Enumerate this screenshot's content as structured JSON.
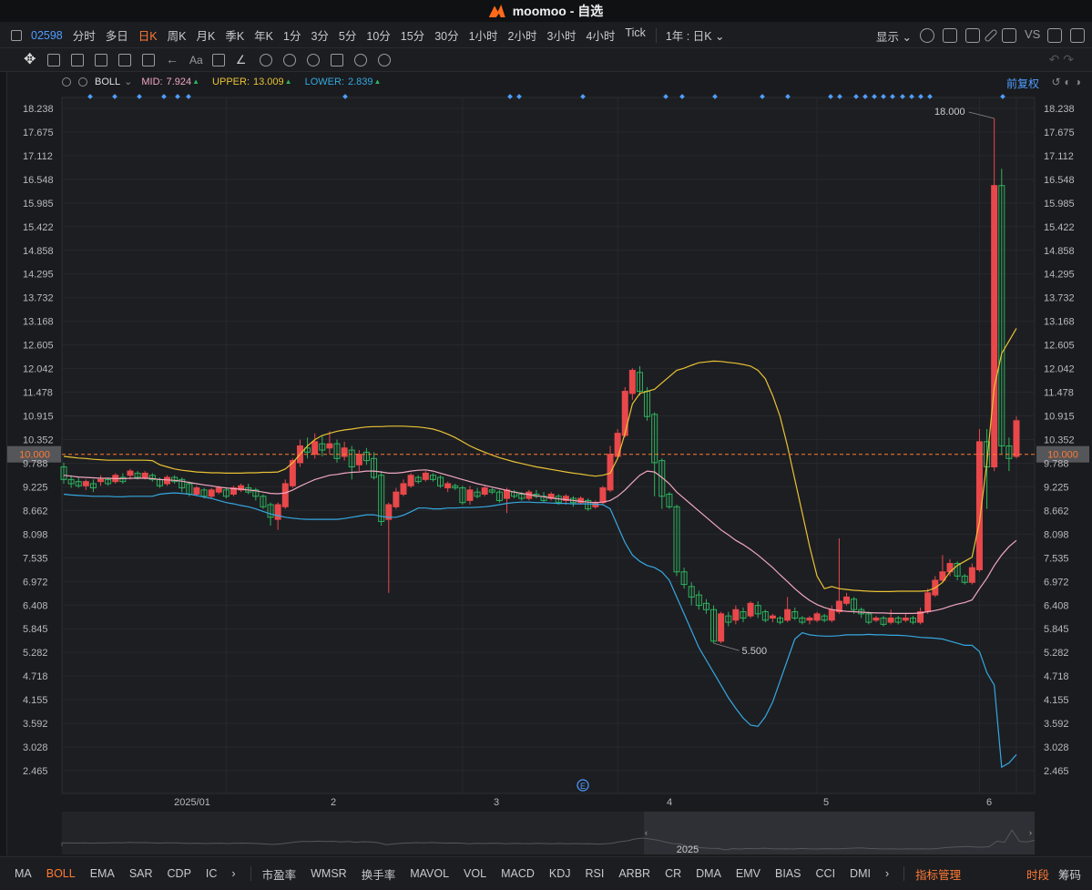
{
  "window": {
    "title": "moomoo - 自选"
  },
  "toolbar": {
    "code": "02598",
    "periods": [
      "分时",
      "多日",
      "日K",
      "周K",
      "月K",
      "季K",
      "年K",
      "1分",
      "3分",
      "5分",
      "10分",
      "15分",
      "30分",
      "1小时",
      "2小时",
      "3小时",
      "4小时",
      "Tick"
    ],
    "selected_period": "日K",
    "range_label": "1年 : 日K",
    "display_label": "显示"
  },
  "indicator": {
    "name": "BOLL",
    "mid_label": "MID:",
    "mid_value": "7.924",
    "upper_label": "UPPER:",
    "upper_value": "13.009",
    "lower_label": "LOWER:",
    "lower_value": "2.839",
    "adjust_label": "前复权"
  },
  "chart_data": {
    "type": "candlestick",
    "y_ticks": [
      "18.238",
      "17.675",
      "17.112",
      "16.548",
      "15.985",
      "15.422",
      "14.858",
      "14.295",
      "13.732",
      "13.168",
      "12.605",
      "12.042",
      "11.478",
      "10.915",
      "10.352",
      "9.788",
      "9.225",
      "8.662",
      "8.098",
      "7.535",
      "6.972",
      "6.408",
      "5.845",
      "5.282",
      "4.718",
      "4.155",
      "3.592",
      "3.028",
      "2.465"
    ],
    "ylim": [
      2.465,
      18.238
    ],
    "x_ticks": [
      "2025/01",
      "2",
      "3",
      "4",
      "5",
      "6"
    ],
    "current_price": "10.000",
    "high_annotation": "18.000",
    "low_annotation": "5.500",
    "candles": [
      [
        9.7,
        9.4,
        9.8,
        9.3
      ],
      [
        9.4,
        9.3,
        9.5,
        9.2
      ],
      [
        9.35,
        9.25,
        9.45,
        9.2
      ],
      [
        9.25,
        9.35,
        9.4,
        9.15
      ],
      [
        9.3,
        9.2,
        9.4,
        9.1
      ],
      [
        9.35,
        9.4,
        9.5,
        9.25
      ],
      [
        9.4,
        9.3,
        9.45,
        9.25
      ],
      [
        9.35,
        9.5,
        9.55,
        9.3
      ],
      [
        9.45,
        9.35,
        9.55,
        9.3
      ],
      [
        9.5,
        9.6,
        9.65,
        9.4
      ],
      [
        9.55,
        9.45,
        9.6,
        9.4
      ],
      [
        9.45,
        9.55,
        9.6,
        9.4
      ],
      [
        9.5,
        9.4,
        9.55,
        9.35
      ],
      [
        9.4,
        9.25,
        9.45,
        9.2
      ],
      [
        9.3,
        9.45,
        9.5,
        9.25
      ],
      [
        9.45,
        9.35,
        9.5,
        9.3
      ],
      [
        9.4,
        9.2,
        9.45,
        9.1
      ],
      [
        9.3,
        9.05,
        9.35,
        9.0
      ],
      [
        9.05,
        9.2,
        9.25,
        9.0
      ],
      [
        9.15,
        9.0,
        9.2,
        8.95
      ],
      [
        9.0,
        9.15,
        9.2,
        8.95
      ],
      [
        9.1,
        9.2,
        9.25,
        9.05
      ],
      [
        9.15,
        9.0,
        9.2,
        8.95
      ],
      [
        9.05,
        9.2,
        9.25,
        9.0
      ],
      [
        9.15,
        9.25,
        9.3,
        9.1
      ],
      [
        9.2,
        9.1,
        9.3,
        9.05
      ],
      [
        9.15,
        9.0,
        9.2,
        8.9
      ],
      [
        9.0,
        8.75,
        9.05,
        8.7
      ],
      [
        8.8,
        8.5,
        8.85,
        8.3
      ],
      [
        8.45,
        8.8,
        8.85,
        8.2
      ],
      [
        8.75,
        9.3,
        9.4,
        8.7
      ],
      [
        9.25,
        9.85,
        9.9,
        9.2
      ],
      [
        9.8,
        10.2,
        10.35,
        9.7
      ],
      [
        10.15,
        10.05,
        10.4,
        9.9
      ],
      [
        10.0,
        10.3,
        10.5,
        9.9
      ],
      [
        10.25,
        10.1,
        10.45,
        9.95
      ],
      [
        10.15,
        10.25,
        10.55,
        10.0
      ],
      [
        10.25,
        9.9,
        10.35,
        9.8
      ],
      [
        9.95,
        10.15,
        10.3,
        9.85
      ],
      [
        10.1,
        9.7,
        10.2,
        9.4
      ],
      [
        9.75,
        10.0,
        10.1,
        9.6
      ],
      [
        10.05,
        9.85,
        10.15,
        9.75
      ],
      [
        9.9,
        9.45,
        10.05,
        9.4
      ],
      [
        9.5,
        8.4,
        9.6,
        8.3
      ],
      [
        8.45,
        8.8,
        8.85,
        6.7
      ],
      [
        8.75,
        9.1,
        9.2,
        8.7
      ],
      [
        9.05,
        9.3,
        9.4,
        9.0
      ],
      [
        9.25,
        9.5,
        9.55,
        9.2
      ],
      [
        9.45,
        9.35,
        9.5,
        9.3
      ],
      [
        9.4,
        9.55,
        9.6,
        9.35
      ],
      [
        9.5,
        9.4,
        9.55,
        9.35
      ],
      [
        9.45,
        9.25,
        9.5,
        9.2
      ],
      [
        9.2,
        9.3,
        9.35,
        9.1
      ],
      [
        9.25,
        9.2,
        9.3,
        9.15
      ],
      [
        9.2,
        8.85,
        9.25,
        8.8
      ],
      [
        8.9,
        9.15,
        9.25,
        8.8
      ],
      [
        9.1,
        9.0,
        9.2,
        8.95
      ],
      [
        9.05,
        9.2,
        9.25,
        9.0
      ],
      [
        9.15,
        9.1,
        9.2,
        9.05
      ],
      [
        9.1,
        8.9,
        9.15,
        8.85
      ],
      [
        8.95,
        9.15,
        9.2,
        8.6
      ],
      [
        9.1,
        9.0,
        9.15,
        8.95
      ],
      [
        9.05,
        8.95,
        9.1,
        8.9
      ],
      [
        8.95,
        9.1,
        9.15,
        8.9
      ],
      [
        9.05,
        9.0,
        9.15,
        8.95
      ],
      [
        9.0,
        8.9,
        9.1,
        8.85
      ],
      [
        8.95,
        9.05,
        9.1,
        8.9
      ],
      [
        9.0,
        8.85,
        9.05,
        8.8
      ],
      [
        8.9,
        9.0,
        9.05,
        8.8
      ],
      [
        8.95,
        8.85,
        9.0,
        8.75
      ],
      [
        8.85,
        8.95,
        9.0,
        8.8
      ],
      [
        8.9,
        8.7,
        8.95,
        8.65
      ],
      [
        8.75,
        8.85,
        8.9,
        8.7
      ],
      [
        8.85,
        9.2,
        9.25,
        8.8
      ],
      [
        9.15,
        10.0,
        10.2,
        9.1
      ],
      [
        9.95,
        10.5,
        10.6,
        9.9
      ],
      [
        10.45,
        11.5,
        11.6,
        10.4
      ],
      [
        11.45,
        12.0,
        12.05,
        11.3
      ],
      [
        11.95,
        11.5,
        12.1,
        11.4
      ],
      [
        11.5,
        10.9,
        11.6,
        10.8
      ],
      [
        10.95,
        9.8,
        11.0,
        9.0
      ],
      [
        9.85,
        9.0,
        9.9,
        8.7
      ],
      [
        9.05,
        8.75,
        9.1,
        8.7
      ],
      [
        8.75,
        7.2,
        8.8,
        7.1
      ],
      [
        7.2,
        6.9,
        7.3,
        6.8
      ],
      [
        6.85,
        6.6,
        6.95,
        6.4
      ],
      [
        6.65,
        6.4,
        6.75,
        6.3
      ],
      [
        6.45,
        6.3,
        6.55,
        6.2
      ],
      [
        6.3,
        5.55,
        6.4,
        5.5
      ],
      [
        5.55,
        6.2,
        6.25,
        5.5
      ],
      [
        6.15,
        6.0,
        6.25,
        5.9
      ],
      [
        6.05,
        6.3,
        6.4,
        5.95
      ],
      [
        6.25,
        6.1,
        6.35,
        6.0
      ],
      [
        6.15,
        6.45,
        6.5,
        6.1
      ],
      [
        6.4,
        6.2,
        6.5,
        6.1
      ],
      [
        6.25,
        6.05,
        6.3,
        6.0
      ],
      [
        6.1,
        6.15,
        6.2,
        6.0
      ],
      [
        6.1,
        6.0,
        6.15,
        5.95
      ],
      [
        6.05,
        6.3,
        6.6,
        6.0
      ],
      [
        6.25,
        6.1,
        6.35,
        6.05
      ],
      [
        6.1,
        6.0,
        6.15,
        5.95
      ],
      [
        6.05,
        6.1,
        6.15,
        5.95
      ],
      [
        6.05,
        6.2,
        6.25,
        6.0
      ],
      [
        6.15,
        6.05,
        6.2,
        6.0
      ],
      [
        6.05,
        6.3,
        6.4,
        6.0
      ],
      [
        6.25,
        6.5,
        8.0,
        6.2
      ],
      [
        6.45,
        6.6,
        6.7,
        6.4
      ],
      [
        6.55,
        6.3,
        6.6,
        6.2
      ],
      [
        6.3,
        6.2,
        6.35,
        6.1
      ],
      [
        6.2,
        6.0,
        6.25,
        5.95
      ],
      [
        6.05,
        6.1,
        6.15,
        6.0
      ],
      [
        6.1,
        5.95,
        6.15,
        5.9
      ],
      [
        6.0,
        6.1,
        6.3,
        5.95
      ],
      [
        6.1,
        6.0,
        6.15,
        5.95
      ],
      [
        6.05,
        6.1,
        6.2,
        6.0
      ],
      [
        6.1,
        6.0,
        6.15,
        5.95
      ],
      [
        6.0,
        6.25,
        6.35,
        5.95
      ],
      [
        6.25,
        6.7,
        6.8,
        6.2
      ],
      [
        6.65,
        7.0,
        7.1,
        6.6
      ],
      [
        7.0,
        7.2,
        7.6,
        6.95
      ],
      [
        7.2,
        7.4,
        7.5,
        7.1
      ],
      [
        7.4,
        7.1,
        7.45,
        7.0
      ],
      [
        7.1,
        6.95,
        7.15,
        6.9
      ],
      [
        6.95,
        7.3,
        7.4,
        6.9
      ],
      [
        7.25,
        10.3,
        10.6,
        7.2
      ],
      [
        10.3,
        9.7,
        10.6,
        8.7
      ],
      [
        9.7,
        16.4,
        18.0,
        9.6
      ],
      [
        16.4,
        10.2,
        16.8,
        10.0
      ],
      [
        10.2,
        9.9,
        10.4,
        9.6
      ],
      [
        9.95,
        10.8,
        10.9,
        9.9
      ]
    ],
    "mid": [
      9.5,
      9.48,
      9.46,
      9.45,
      9.44,
      9.43,
      9.43,
      9.42,
      9.42,
      9.43,
      9.43,
      9.43,
      9.42,
      9.4,
      9.39,
      9.38,
      9.36,
      9.33,
      9.3,
      9.27,
      9.25,
      9.22,
      9.2,
      9.18,
      9.17,
      9.15,
      9.13,
      9.1,
      9.07,
      9.06,
      9.08,
      9.15,
      9.24,
      9.32,
      9.4,
      9.45,
      9.5,
      9.52,
      9.55,
      9.57,
      9.58,
      9.6,
      9.6,
      9.58,
      9.55,
      9.55,
      9.57,
      9.6,
      9.62,
      9.63,
      9.6,
      9.55,
      9.5,
      9.45,
      9.4,
      9.35,
      9.3,
      9.26,
      9.22,
      9.18,
      9.14,
      9.1,
      9.07,
      9.04,
      9.01,
      8.99,
      8.96,
      8.94,
      8.92,
      8.9,
      8.88,
      8.86,
      8.85,
      8.86,
      8.9,
      9.0,
      9.15,
      9.33,
      9.5,
      9.6,
      9.58,
      9.45,
      9.3,
      9.1,
      8.95,
      8.8,
      8.65,
      8.5,
      8.35,
      8.2,
      8.08,
      7.95,
      7.85,
      7.73,
      7.6,
      7.45,
      7.3,
      7.13,
      6.97,
      6.8,
      6.65,
      6.52,
      6.42,
      6.35,
      6.3,
      6.28,
      6.26,
      6.25,
      6.24,
      6.23,
      6.22,
      6.22,
      6.21,
      6.21,
      6.21,
      6.21,
      6.22,
      6.25,
      6.28,
      6.32,
      6.38,
      6.43,
      6.47,
      6.53,
      6.8,
      7.05,
      7.35,
      7.6,
      7.8,
      7.95
    ],
    "upper": [
      9.95,
      9.93,
      9.91,
      9.9,
      9.88,
      9.87,
      9.86,
      9.86,
      9.86,
      9.86,
      9.86,
      9.86,
      9.85,
      9.75,
      9.7,
      9.65,
      9.62,
      9.6,
      9.58,
      9.57,
      9.56,
      9.56,
      9.55,
      9.55,
      9.55,
      9.56,
      9.56,
      9.57,
      9.57,
      9.58,
      9.65,
      9.8,
      10.0,
      10.2,
      10.35,
      10.45,
      10.5,
      10.55,
      10.58,
      10.6,
      10.63,
      10.65,
      10.66,
      10.66,
      10.67,
      10.67,
      10.67,
      10.66,
      10.65,
      10.63,
      10.6,
      10.55,
      10.48,
      10.4,
      10.3,
      10.2,
      10.12,
      10.05,
      9.98,
      9.92,
      9.87,
      9.82,
      9.78,
      9.74,
      9.7,
      9.67,
      9.64,
      9.61,
      9.58,
      9.55,
      9.53,
      9.5,
      9.48,
      9.5,
      9.55,
      9.9,
      10.5,
      11.2,
      11.45,
      11.5,
      11.55,
      11.7,
      11.85,
      12.0,
      12.05,
      12.12,
      12.18,
      12.2,
      12.22,
      12.21,
      12.19,
      12.17,
      12.14,
      12.1,
      12.0,
      11.8,
      11.4,
      10.9,
      10.2,
      9.4,
      8.6,
      7.8,
      7.1,
      6.8,
      6.85,
      6.8,
      6.78,
      6.76,
      6.75,
      6.74,
      6.73,
      6.73,
      6.73,
      6.74,
      6.74,
      6.74,
      6.74,
      6.75,
      6.82,
      6.95,
      7.2,
      7.35,
      7.45,
      7.55,
      8.4,
      9.8,
      11.6,
      12.4,
      12.7,
      13.0
    ],
    "lower": [
      9.05,
      9.03,
      9.02,
      9.01,
      9.0,
      9.0,
      9.0,
      8.99,
      8.99,
      9.0,
      9.0,
      9.0,
      9.0,
      9.05,
      9.07,
      9.08,
      9.07,
      9.05,
      9.02,
      8.98,
      8.95,
      8.9,
      8.85,
      8.82,
      8.78,
      8.75,
      8.7,
      8.64,
      8.58,
      8.54,
      8.5,
      8.48,
      8.46,
      8.45,
      8.45,
      8.45,
      8.45,
      8.45,
      8.47,
      8.5,
      8.53,
      8.56,
      8.56,
      8.52,
      8.5,
      8.5,
      8.55,
      8.63,
      8.72,
      8.72,
      8.7,
      8.7,
      8.72,
      8.72,
      8.73,
      8.73,
      8.74,
      8.75,
      8.77,
      8.8,
      8.83,
      8.85,
      8.86,
      8.86,
      8.85,
      8.85,
      8.84,
      8.83,
      8.83,
      8.82,
      8.82,
      8.82,
      8.81,
      8.8,
      8.7,
      8.3,
      7.9,
      7.6,
      7.45,
      7.35,
      7.3,
      7.2,
      7.0,
      6.6,
      6.2,
      5.8,
      5.4,
      5.1,
      4.8,
      4.5,
      4.2,
      3.95,
      3.72,
      3.55,
      3.52,
      3.75,
      4.1,
      4.6,
      5.1,
      5.6,
      5.75,
      5.7,
      5.68,
      5.67,
      5.67,
      5.68,
      5.7,
      5.7,
      5.7,
      5.71,
      5.7,
      5.7,
      5.69,
      5.69,
      5.68,
      5.66,
      5.64,
      5.63,
      5.62,
      5.6,
      5.55,
      5.5,
      5.45,
      5.45,
      5.3,
      4.8,
      4.5,
      2.55,
      2.65,
      2.85
    ]
  },
  "bottom": {
    "indicators": [
      "MA",
      "BOLL",
      "EMA",
      "SAR",
      "CDP",
      "IC",
      "市盈率",
      "WMSR",
      "换手率",
      "MAVOL",
      "VOL",
      "MACD",
      "KDJ",
      "RSI",
      "ARBR",
      "CR",
      "DMA",
      "EMV",
      "BIAS",
      "CCI",
      "DMI"
    ],
    "selected": "BOLL",
    "manage_label": "指标管理",
    "right_items": [
      "时段",
      "筹码"
    ],
    "nav_year": "2025"
  },
  "colors": {
    "up": "#e8484b",
    "down": "#2db35d",
    "mid": "#f0a7c0",
    "upper": "#e9c234",
    "lower": "#35a8e0",
    "current": "#ff7a33"
  }
}
